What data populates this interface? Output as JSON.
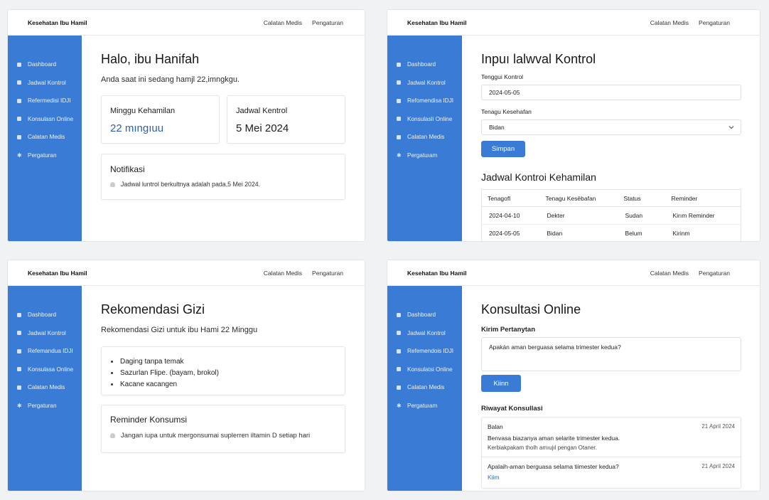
{
  "brand": "Kesehatan Ibu Hamil",
  "accent": "#3a7bd5",
  "screens": {
    "dashboard": {
      "topnav": [
        "Calatan Medis",
        "Pengaturan"
      ],
      "sidebar": [
        "Dashboard",
        "Jadwal Kontrol",
        "Refermedisi IDJI",
        "Konsulasn Online",
        "Calatan Medis",
        "Pergaturan"
      ],
      "title": "Halo, ibu Hanifah",
      "subtitle": "Anda saat ini sedang hamjl 22,imngkgu.",
      "week_card": {
        "label": "Minggu Kehamilan",
        "value": "22 mıngıuu"
      },
      "control_card": {
        "label": "Jadwal Kentrol",
        "value": "5 Mei 2024"
      },
      "notif": {
        "title": "Notifikasi",
        "text": "Jadwal luntrol berkultnya adalah pada,5 Mei 2024."
      }
    },
    "schedule": {
      "topnav": [
        "Calatan Medis",
        "Pengaturan"
      ],
      "sidebar": [
        "Dashboard",
        "Jadwal Kontrol",
        "Refomendisa IDJI",
        "Konsulasli Online",
        "Calatan Medis",
        "Pergatuıam"
      ],
      "title": "Inpuı lalwval Kontrol",
      "date_label": "Tenggui Kontrol",
      "date_value": "2024-05-05",
      "staff_label": "Tenagu Kesehafan",
      "staff_value": "Bidan",
      "save_label": "Simpan",
      "table_title": "Jadwal Kontroi Kehamilan",
      "columns": [
        "Tenagofl",
        "Tenagu Kesēbafan",
        "Status",
        "Reminder"
      ],
      "rows": [
        [
          "2024-04-10",
          "Dekter",
          "Sudan",
          "Kirım Reminder"
        ],
        [
          "2024-05-05",
          "Bidan",
          "Belum",
          "Kirinm"
        ]
      ]
    },
    "nutrition": {
      "topnav": [
        "Calatan Medis",
        "Pengaturan"
      ],
      "sidebar": [
        "Dashboard",
        "Jadwal Kontrol",
        "Refemandua IDJI",
        "Konsulasa Online",
        "Calatan Medis",
        "Pergaturan"
      ],
      "title": "Rekomendasi Gizi",
      "subtitle": "Rekomendasi Gizi untuk ibu Hami 22 Minggu",
      "items": [
        "Daging tanpa temak",
        "Sazurlan Flipe. (bayam, brokol)",
        "Kacane ᴋacangen"
      ],
      "reminder_title": "Reminder Konsumsi",
      "reminder_text": "Jangan iupa untuk mergonsumai suplerren iltamin D setiap hari"
    },
    "consult": {
      "topnav": [
        "Calatan Medis",
        "Pengaturan"
      ],
      "sidebar": [
        "Dashboard",
        "Jadwal Kontrol",
        "Refemendois IDJI",
        "Konsulatsi Online",
        "Calatan Medis",
        "Pergatuıam"
      ],
      "title": "Konsultasi Online",
      "ask_label": "Kirim Pertanytan",
      "question": "Apakán aman berguasa selama trimester kedua?",
      "send_label": "Kiinn",
      "history_title": "Riwayat Konsullasi",
      "history": [
        {
          "from": "Balan",
          "date": "21 April 2024",
          "line1": "Benvasa biazanya aman selarite trimester kedua.",
          "line2": "Kerbiakpakam tholh amıujıl pengan Otaner."
        },
        {
          "from": "Apalaih-aman berguasa selama tiimester kedua?",
          "date": "21 April 2024",
          "line1": "Kiim",
          "line2": ""
        }
      ]
    }
  }
}
